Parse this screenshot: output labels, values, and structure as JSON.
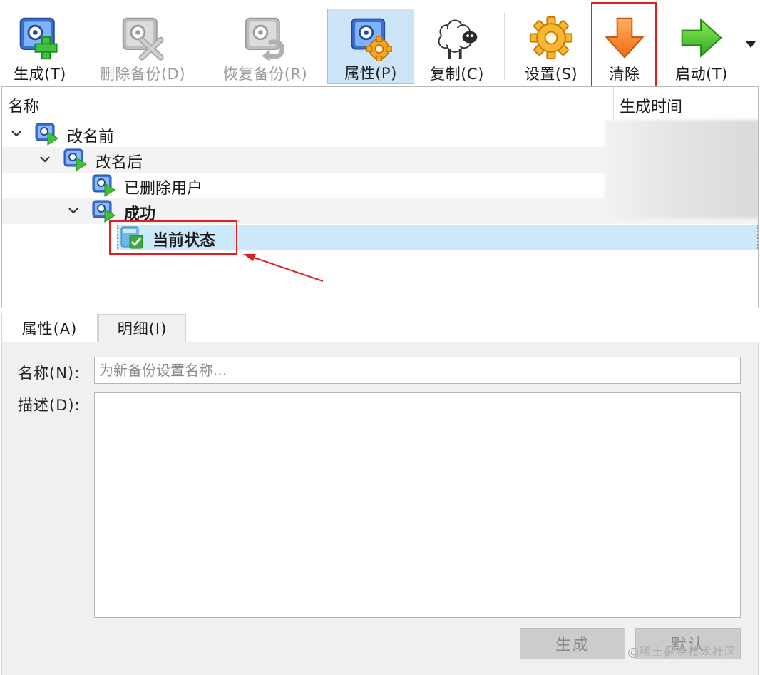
{
  "toolbar": {
    "items": [
      {
        "label": "生成(T)",
        "icon": "backup-add-icon",
        "state": "normal"
      },
      {
        "label": "删除备份(D)",
        "icon": "backup-delete-icon",
        "state": "disabled"
      },
      {
        "label": "恢复备份(R)",
        "icon": "backup-restore-icon",
        "state": "disabled"
      },
      {
        "label": "属性(P)",
        "icon": "properties-gear-icon",
        "state": "active"
      },
      {
        "label": "复制(C)",
        "icon": "sheep-clone-icon",
        "state": "normal"
      },
      {
        "label": "设置(S)",
        "icon": "settings-gear-icon",
        "state": "normal"
      },
      {
        "label": "清除",
        "icon": "down-arrow-discard-icon",
        "state": "highlighted"
      },
      {
        "label": "启动(T)",
        "icon": "right-arrow-start-icon",
        "state": "normal"
      }
    ]
  },
  "tree": {
    "columns": {
      "name": "名称",
      "time": "生成时间"
    },
    "nodes": [
      {
        "label": "改名前",
        "level": 0,
        "expanded": true,
        "bold": false
      },
      {
        "label": "改名后",
        "level": 1,
        "expanded": true,
        "bold": false
      },
      {
        "label": "已删除用户",
        "level": 2,
        "expanded": false,
        "bold": false
      },
      {
        "label": "成功",
        "level": 2,
        "expanded": true,
        "bold": true
      },
      {
        "label": "当前状态",
        "level": 3,
        "expanded": false,
        "bold": true,
        "selected": true
      }
    ]
  },
  "tabs": {
    "attributes": "属性(A)",
    "details": "明细(I)"
  },
  "properties": {
    "name_label": "名称(N):",
    "name_placeholder": "为新备份设置名称...",
    "name_value": "",
    "desc_label": "描述(D):",
    "desc_value": "",
    "generate_button": "生成",
    "default_button": "默认"
  },
  "watermark": "@稀土掘金技术社区",
  "colors": {
    "active": "#cce4f7",
    "selection": "#cce8fb",
    "highlight": "#e02020"
  }
}
